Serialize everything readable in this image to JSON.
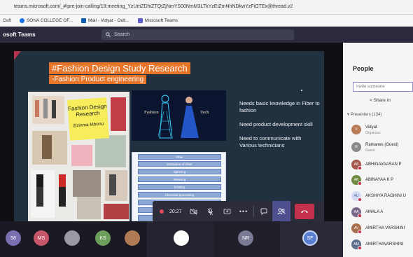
{
  "browser": {
    "url": "teams.microsoft.com/_#/pre-join-calling/19:meeting_YzUmZDhiZTQtZjNmYS00NmM3LTkYzEtZmNhNDkwYzFiOTEx@thread.v2",
    "bookmarks": [
      {
        "label": "Gsft",
        "icon": "app-icon",
        "color": "#5f6368"
      },
      {
        "label": "SONA COLLEGE OF...",
        "icon": "globe-icon",
        "color": "#1a73e8"
      },
      {
        "label": "Mail - Vidyat - Outl...",
        "icon": "outlook-icon",
        "color": "#0a5fb4"
      },
      {
        "label": "Microsoft Teams",
        "icon": "teams-icon",
        "color": "#5b5fc7"
      }
    ]
  },
  "teams": {
    "brand": "osoft Teams",
    "search_placeholder": "Search"
  },
  "slide": {
    "title": "#Fashion Design Study Research",
    "subtitle": "-Fashion Product engineering",
    "note_title": "Fashion Design Research",
    "note_author": "Ezinma Mbonu",
    "image_caption_left": "Fashion",
    "image_caption_right": "Tech",
    "flow_steps": [
      "Fiber",
      "Extraction of Fiber",
      "Spinning",
      "Weaving",
      "Knitting",
      "Chemical processing",
      "Dyeing",
      "Garmenting",
      "Consumer"
    ],
    "bullets": [
      "Needs basic knowledge in Fiber to fashion",
      "Need product development skill",
      "Need to communicate with Various technicians"
    ]
  },
  "call": {
    "timer": "20:27"
  },
  "participants_bar": [
    {
      "initials": "58",
      "color": "#7a6fb0"
    },
    {
      "initials": "MS",
      "color": "#c8566a"
    },
    {
      "initials": "",
      "color": "#9a9aa4"
    },
    {
      "initials": "KS",
      "color": "#6a9e5a"
    },
    {
      "initials": "",
      "color": "#b07b54"
    },
    {
      "initials": "",
      "color": "#ffffff"
    },
    {
      "initials": "NR",
      "color": "#7a7a94"
    },
    {
      "initials": "SF",
      "color": "#5b7fd0"
    }
  ],
  "people": {
    "title": "People",
    "invite_placeholder": "Invite someone",
    "share_label": "Share in",
    "presenters_label": "Presenters (134)",
    "list": [
      {
        "name": "Vidyat",
        "role": "Organizer",
        "initials": "V"
      },
      {
        "name": "Ramanes (Guest)",
        "role": "Guest",
        "initials": "R"
      },
      {
        "name": "ABHINAVAASAN P",
        "role": "",
        "initials": "AB"
      },
      {
        "name": "ABINAYAA K P",
        "role": "",
        "initials": "AK"
      },
      {
        "name": "AKSHIYA RAGHINI U",
        "role": "",
        "initials": "AU"
      },
      {
        "name": "AMALA A",
        "role": "",
        "initials": "AA"
      },
      {
        "name": "AMIRTHA VARSHINI",
        "role": "",
        "initials": "AV"
      },
      {
        "name": "AMIRTHAVARSHINI",
        "role": "",
        "initials": "AM"
      }
    ]
  }
}
